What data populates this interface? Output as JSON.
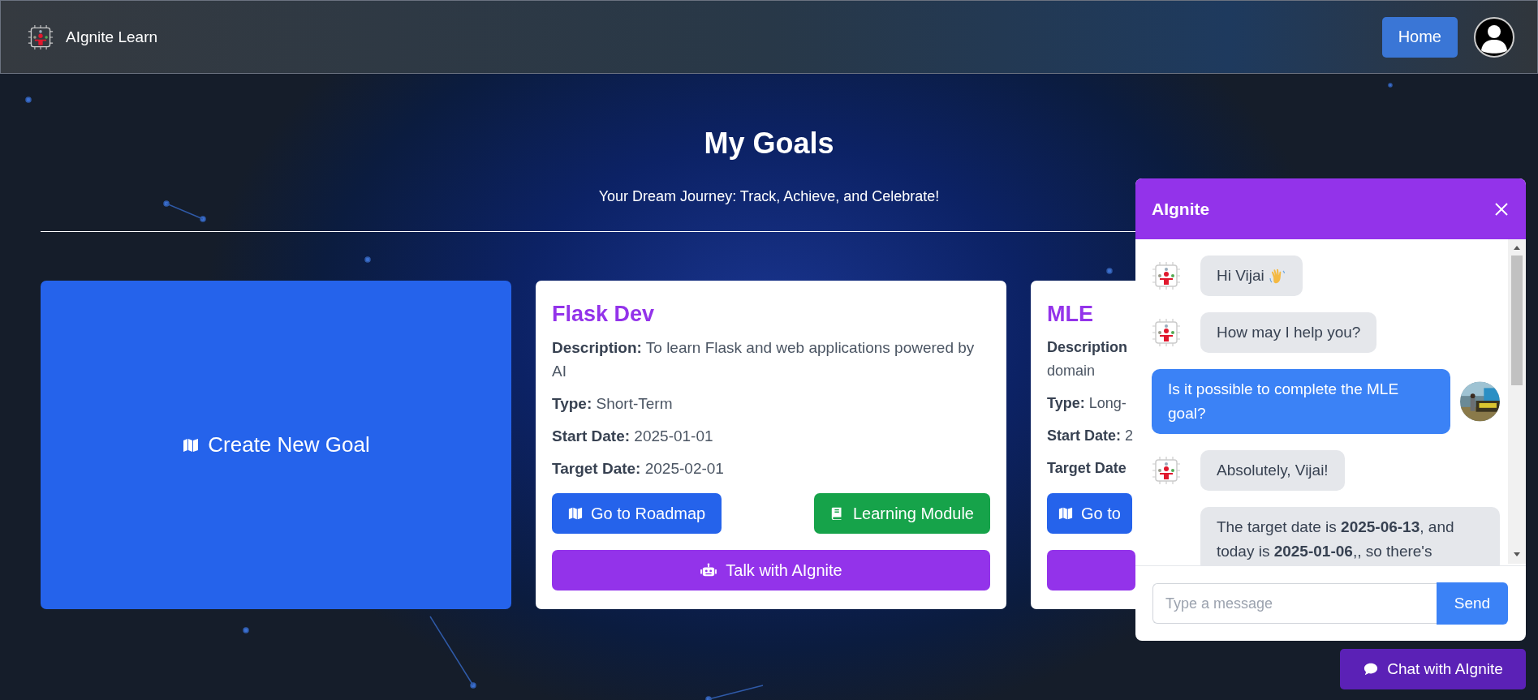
{
  "header": {
    "brand": "AIgnite Learn",
    "nav_button": "Home"
  },
  "page": {
    "title": "My Goals",
    "subtitle": "Your Dream Journey: Track, Achieve, and Celebrate!"
  },
  "create_card": {
    "label": "Create New Goal"
  },
  "goals": [
    {
      "kind": "full",
      "title": "Flask Dev",
      "fields": [
        {
          "label": "Description:",
          "value": "To learn Flask and web applications powered by AI"
        },
        {
          "label": "Type:",
          "value": "Short-Term"
        },
        {
          "label": "Start Date:",
          "value": "2025-01-01"
        },
        {
          "label": "Target Date:",
          "value": "2025-02-01"
        }
      ],
      "buttons": [
        {
          "kind": "roadmap",
          "label": "Go to Roadmap"
        },
        {
          "kind": "module",
          "label": "Learning Module"
        },
        {
          "kind": "talk",
          "label": "Talk with AIgnite"
        }
      ]
    },
    {
      "kind": "clipped",
      "title": "MLE",
      "fields": [
        {
          "label": "Description",
          "value": "domain"
        },
        {
          "label": "Type:",
          "value": "Long-"
        },
        {
          "label": "Start Date:",
          "value": "2"
        },
        {
          "label": "Target Date"
        }
      ],
      "buttons": [
        {
          "kind": "roadmap",
          "label": "Go to"
        },
        {
          "kind": "talk"
        }
      ]
    }
  ],
  "chat": {
    "title": "AIgnite",
    "messages": [
      {
        "kind": "bot",
        "avatar": true,
        "wave_icon": true,
        "text": "Hi Vijai"
      },
      {
        "kind": "bot",
        "avatar": true,
        "wave_icon": false,
        "text": "How may I help you?"
      },
      {
        "kind": "user",
        "avatar": true,
        "wave_icon": false,
        "text": "Is it possible to complete the MLE goal?"
      },
      {
        "kind": "bot",
        "avatar": true,
        "wave_icon": false,
        "text": "Absolutely, Vijai!"
      },
      {
        "kind": "bot",
        "avatar": false,
        "wave_icon": false,
        "text": "The target date is **2025-06-13**, and today is **2025-01-06**,, so there's"
      }
    ],
    "input": {
      "placeholder": "Type a message"
    },
    "send_button": "Send"
  },
  "launcher": {
    "label": "Chat with AIgnite"
  }
}
